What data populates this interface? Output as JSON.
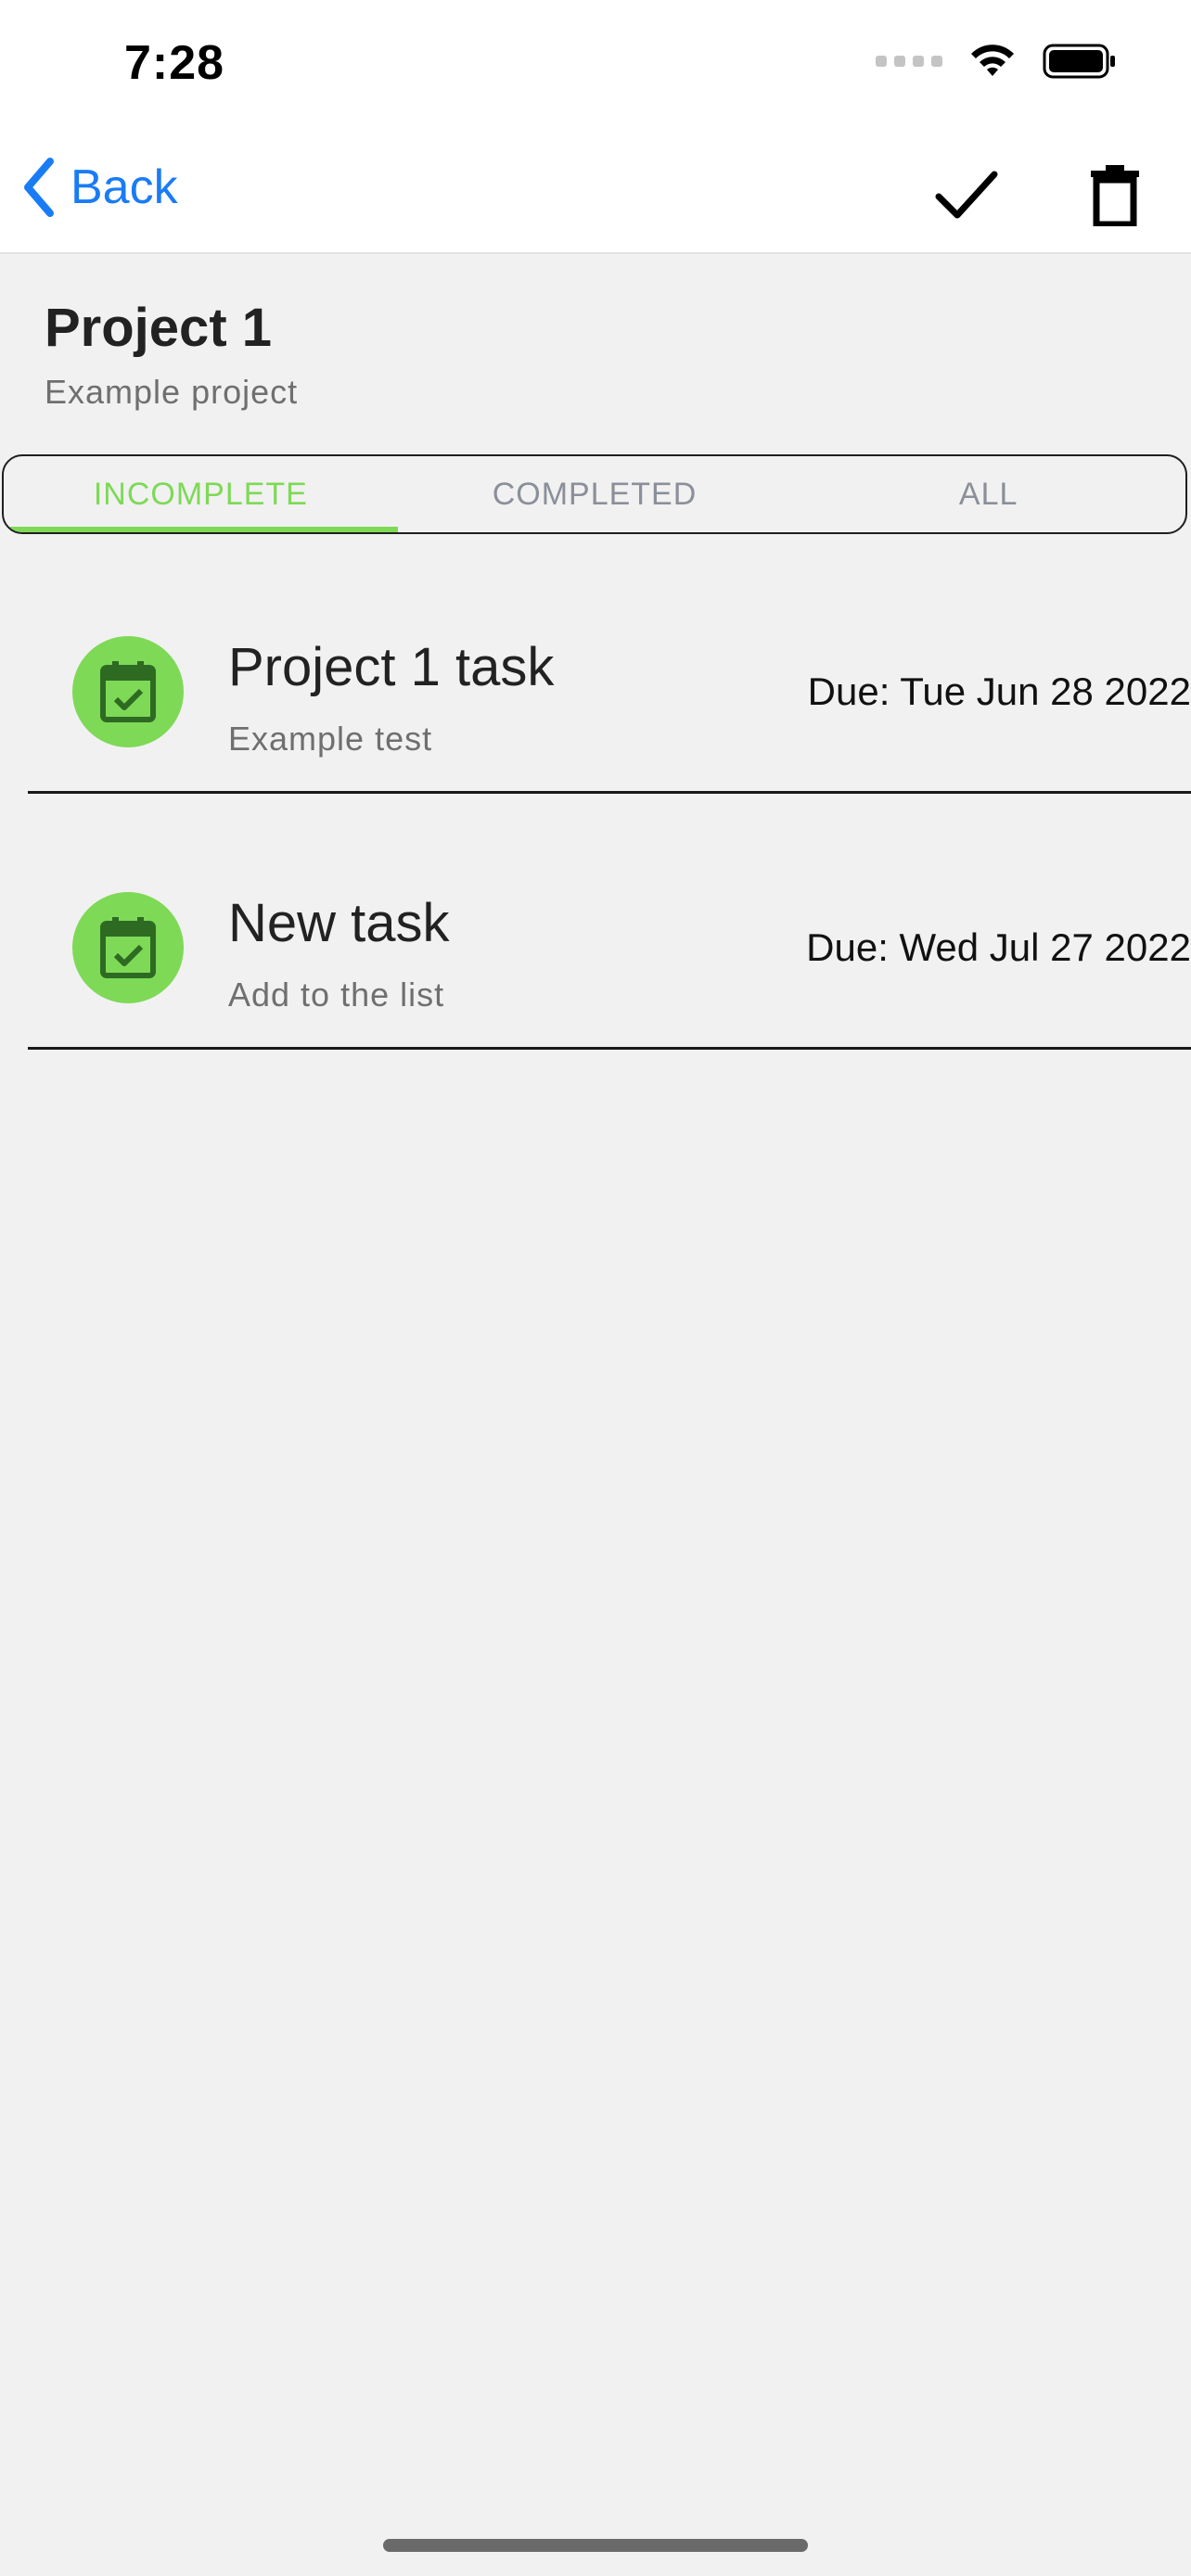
{
  "status_bar": {
    "time": "7:28",
    "icons": [
      "signal-icon",
      "wifi-icon",
      "battery-icon"
    ]
  },
  "nav": {
    "back_label": "Back",
    "actions": [
      "checkmark-icon",
      "trash-icon"
    ],
    "accent_color": "#1a7cf5"
  },
  "project": {
    "title": "Project 1",
    "description": "Example project"
  },
  "tabs": [
    {
      "label": "INCOMPLETE",
      "active": true
    },
    {
      "label": "COMPLETED",
      "active": false
    },
    {
      "label": "ALL",
      "active": false
    }
  ],
  "tasks": [
    {
      "title": "Project 1 task",
      "subtitle": "Example test",
      "due": "Due: Tue Jun 28 2022",
      "icon": "calendar-check-icon"
    },
    {
      "title": "New task",
      "subtitle": "Add to the list",
      "due": "Due: Wed Jul 27 2022",
      "icon": "calendar-check-icon"
    }
  ],
  "colors": {
    "active_tab": "#7ed957",
    "task_icon_bg": "#7ed957",
    "task_icon_fg": "#2e6b22"
  }
}
